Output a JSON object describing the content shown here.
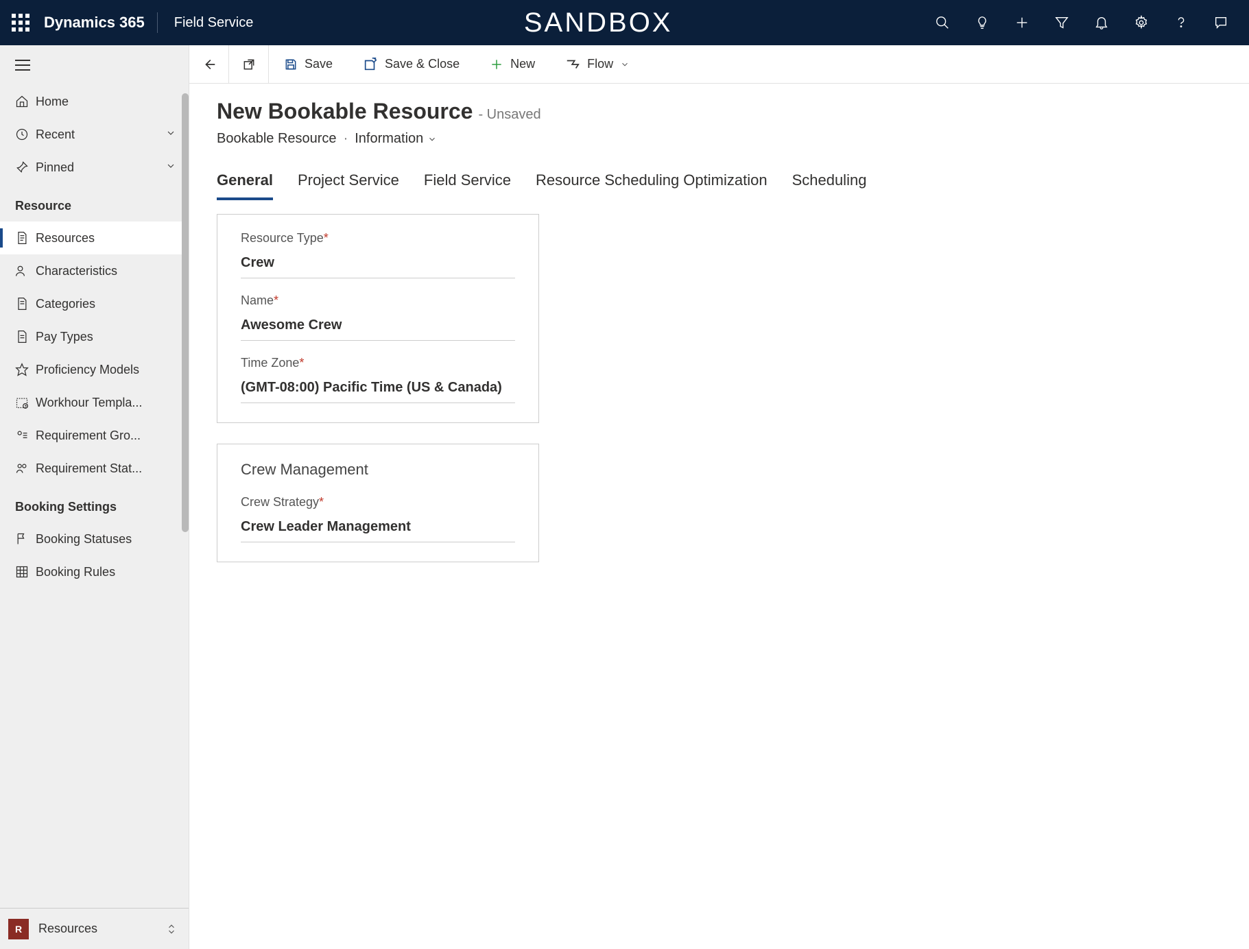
{
  "topbar": {
    "brand": "Dynamics 365",
    "module": "Field Service",
    "environment": "SANDBOX"
  },
  "sidebar": {
    "quick": [
      {
        "label": "Home",
        "icon": "home",
        "chevron": false
      },
      {
        "label": "Recent",
        "icon": "clock",
        "chevron": true
      },
      {
        "label": "Pinned",
        "icon": "pin",
        "chevron": true
      }
    ],
    "groups": [
      {
        "title": "Resource",
        "items": [
          {
            "label": "Resources",
            "icon": "doc",
            "active": true
          },
          {
            "label": "Characteristics",
            "icon": "person",
            "active": false
          },
          {
            "label": "Categories",
            "icon": "doc",
            "active": false
          },
          {
            "label": "Pay Types",
            "icon": "doc",
            "active": false
          },
          {
            "label": "Proficiency Models",
            "icon": "star",
            "active": false
          },
          {
            "label": "Workhour Templa...",
            "icon": "cal",
            "active": false
          },
          {
            "label": "Requirement Gro...",
            "icon": "group",
            "active": false
          },
          {
            "label": "Requirement Stat...",
            "icon": "people",
            "active": false
          }
        ]
      },
      {
        "title": "Booking Settings",
        "items": [
          {
            "label": "Booking Statuses",
            "icon": "flag",
            "active": false
          },
          {
            "label": "Booking Rules",
            "icon": "grid",
            "active": false
          }
        ]
      }
    ],
    "area": {
      "badge": "R",
      "label": "Resources"
    }
  },
  "cmdbar": {
    "save": "Save",
    "saveclose": "Save & Close",
    "new": "New",
    "flow": "Flow"
  },
  "page": {
    "title": "New Bookable Resource",
    "unsaved": "- Unsaved",
    "entity": "Bookable Resource",
    "form": "Information"
  },
  "tabs": [
    "General",
    "Project Service",
    "Field Service",
    "Resource Scheduling Optimization",
    "Scheduling"
  ],
  "form": {
    "section1": {
      "fields": [
        {
          "label": "Resource Type",
          "required": true,
          "value": "Crew"
        },
        {
          "label": "Name",
          "required": true,
          "value": "Awesome Crew"
        },
        {
          "label": "Time Zone",
          "required": true,
          "value": "(GMT-08:00) Pacific Time (US & Canada)"
        }
      ]
    },
    "section2": {
      "title": "Crew Management",
      "fields": [
        {
          "label": "Crew Strategy",
          "required": true,
          "value": "Crew Leader Management"
        }
      ]
    }
  }
}
